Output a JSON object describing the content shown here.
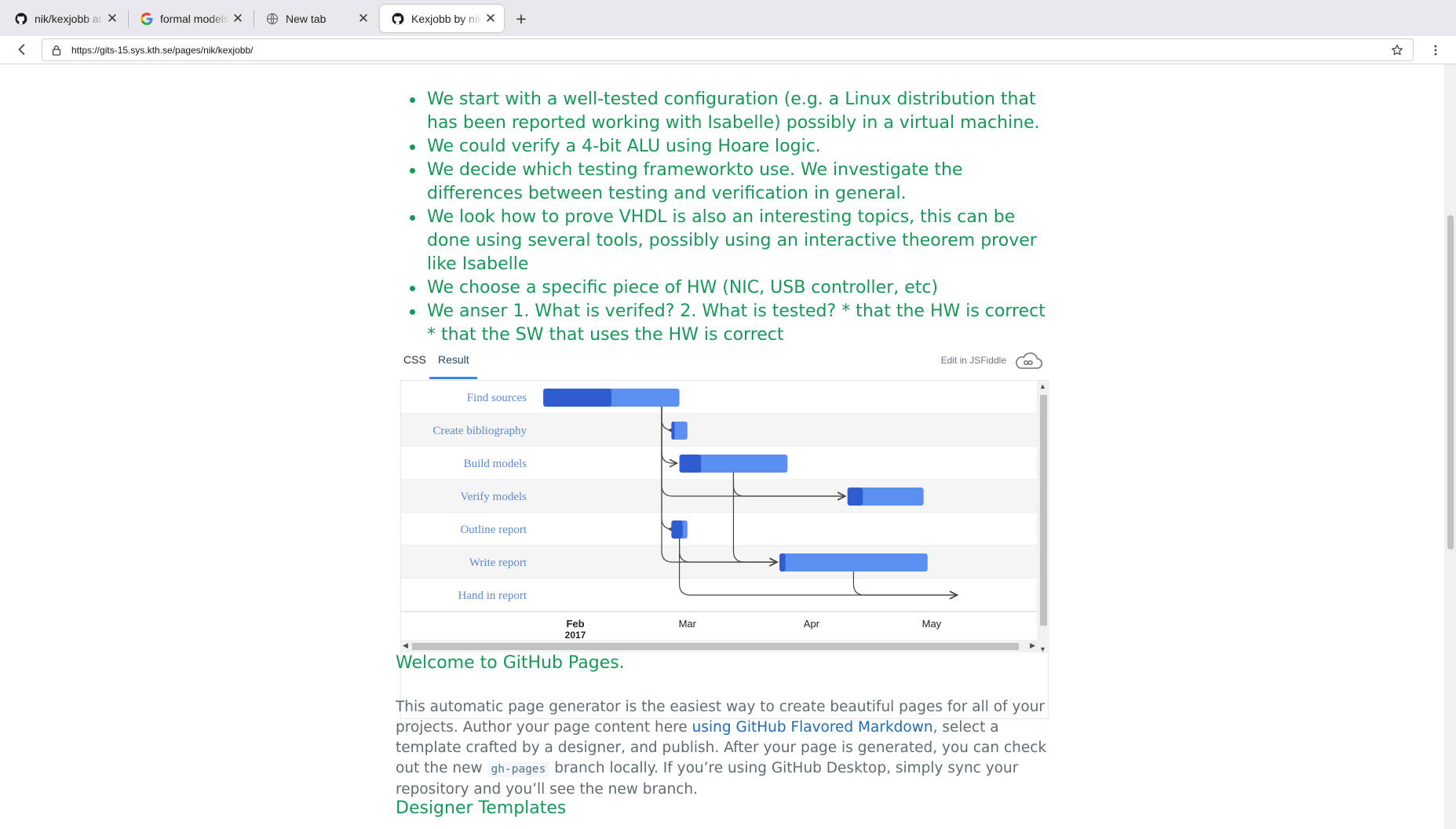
{
  "browser": {
    "tabs": [
      {
        "title": "nik/kexjobb at",
        "favicon": "github-icon",
        "active": false
      },
      {
        "title": "formal models",
        "favicon": "google-icon",
        "active": false
      },
      {
        "title": "New tab",
        "favicon": "globe-icon",
        "active": false
      },
      {
        "title": "Kexjobb by nik",
        "favicon": "github-icon",
        "active": true
      }
    ],
    "new_tab_label": "+",
    "url": "https://gits-15.sys.kth.se/pages/nik/kexjobb/"
  },
  "page": {
    "bullets": [
      "We start with a well-tested configuration (e.g. a Linux distribution that has been reported working with Isabelle) possibly in a virtual machine.",
      "We could verify a 4-bit ALU using Hoare logic.",
      "We decide which testing frameworkto use. We investigate the differences between testing and verification in general.",
      "We look how to prove VHDL is also an interesting topics, this can be done using several tools, possibly using an interactive theorem prover like Isabelle",
      "We choose a specific piece of HW (NIC, USB controller, etc)",
      "We anser 1. What is verifed? 2. What is tested? * that the HW is correct * that the SW that uses the HW is correct"
    ],
    "fiddle": {
      "tabs": [
        "CSS",
        "Result"
      ],
      "active_tab": "Result",
      "edit_label": "Edit in JSFiddle"
    },
    "welcome_heading": "Welcome to GitHub Pages.",
    "paragraph": {
      "part1": "This automatic page generator is the easiest way to create beautiful pages for all of your projects. Author your page content here ",
      "link": "using GitHub Flavored Markdown",
      "part2": ", select a template crafted by a designer, and publish. After your page is generated, you can check out the new ",
      "code": "gh-pages",
      "part3": " branch locally. If you’re using GitHub Desktop, simply sync your repository and you’ll see the new branch."
    },
    "designer_heading": "Designer Templates"
  },
  "chart_data": {
    "type": "gantt",
    "tasks": [
      {
        "name": "Find sources",
        "start": "2017-01-24",
        "end": "2017-02-27",
        "progress": 0.5
      },
      {
        "name": "Create bibliography",
        "start": "2017-02-25",
        "end": "2017-03-01",
        "progress": 0.2
      },
      {
        "name": "Build models",
        "start": "2017-02-27",
        "end": "2017-03-26",
        "progress": 0.2
      },
      {
        "name": "Verify models",
        "start": "2017-04-10",
        "end": "2017-04-29",
        "progress": 0.2
      },
      {
        "name": "Outline report",
        "start": "2017-02-25",
        "end": "2017-03-01",
        "progress": 0.7
      },
      {
        "name": "Write report",
        "start": "2017-03-24",
        "end": "2017-04-30",
        "progress": 0.04
      },
      {
        "name": "Hand in report",
        "start": "2017-05-08",
        "end": "2017-05-08",
        "progress": 0
      }
    ],
    "dependencies": [
      {
        "from": "Find sources",
        "to": "Create bibliography"
      },
      {
        "from": "Find sources",
        "to": "Build models"
      },
      {
        "from": "Find sources",
        "to": "Verify models"
      },
      {
        "from": "Find sources",
        "to": "Outline report"
      },
      {
        "from": "Find sources",
        "to": "Write report"
      },
      {
        "from": "Build models",
        "to": "Verify models"
      },
      {
        "from": "Build models",
        "to": "Write report"
      },
      {
        "from": "Outline report",
        "to": "Write report"
      },
      {
        "from": "Outline report",
        "to": "Hand in report"
      },
      {
        "from": "Write report",
        "to": "Hand in report"
      }
    ],
    "x_ticks": [
      {
        "label": "Feb",
        "sub": "2017",
        "date": "2017-02-01"
      },
      {
        "label": "Mar",
        "sub": "",
        "date": "2017-03-01"
      },
      {
        "label": "Apr",
        "sub": "",
        "date": "2017-04-01"
      },
      {
        "label": "May",
        "sub": "",
        "date": "2017-05-01"
      }
    ],
    "colors": {
      "bar": "#5b8ff0",
      "progress": "#2f5ccf",
      "label": "#5c8ad6",
      "arrow": "#444444"
    }
  }
}
